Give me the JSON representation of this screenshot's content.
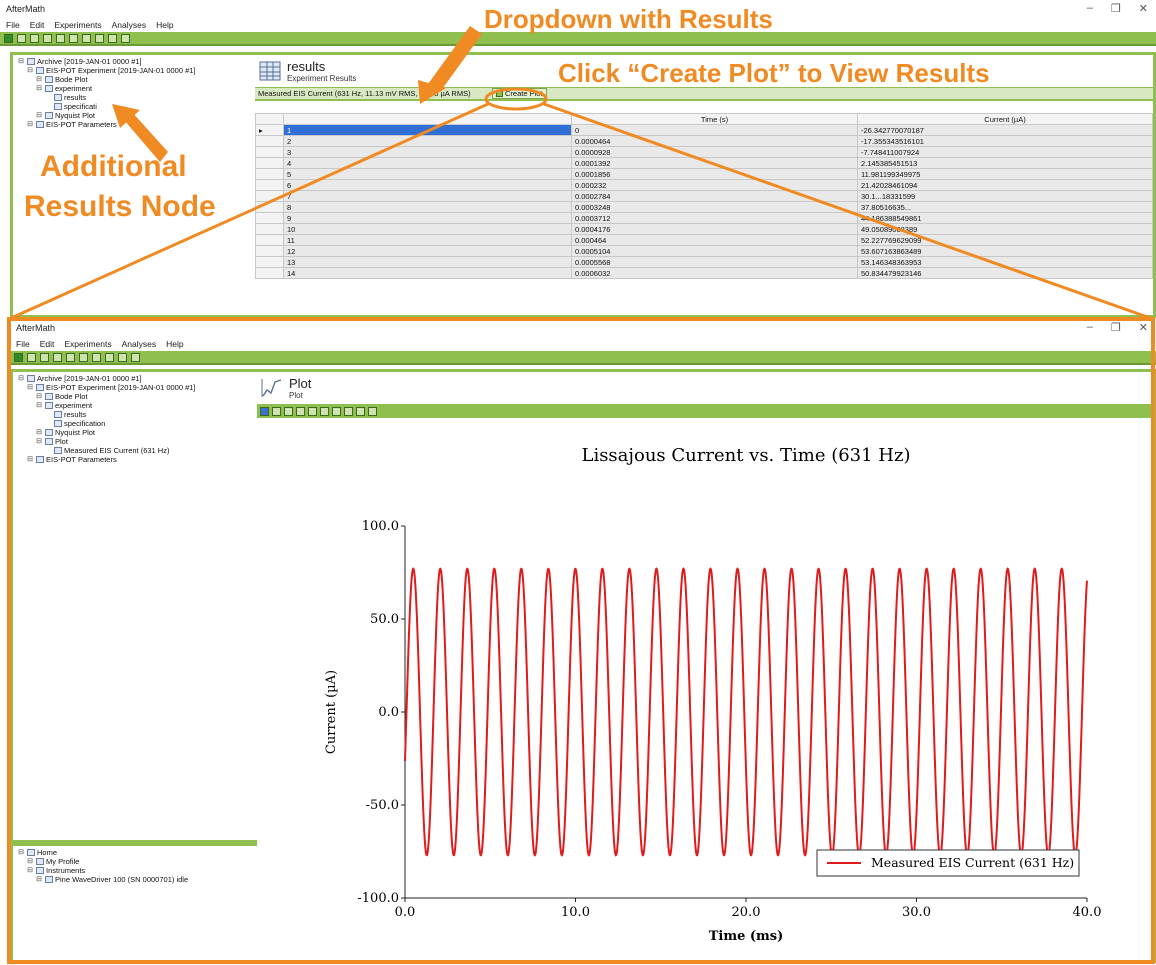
{
  "app": {
    "title": "AfterMath",
    "menu": [
      "File",
      "Edit",
      "Experiments",
      "Analyses",
      "Help"
    ]
  },
  "top": {
    "tree": [
      {
        "label": "Archive [2019-JAN-01 0000 #1]",
        "indent": 0
      },
      {
        "label": "EIS-POT Experiment [2019-JAN-01 0000 #1]",
        "indent": 1
      },
      {
        "label": "Bode Plot",
        "indent": 2
      },
      {
        "label": "experiment",
        "indent": 2
      },
      {
        "label": "results",
        "indent": 3
      },
      {
        "label": "specificati",
        "indent": 3
      },
      {
        "label": "Nyquist Plot",
        "indent": 2
      },
      {
        "label": "EIS-POT Parameters",
        "indent": 1
      }
    ],
    "header_title": "results",
    "header_sub": "Experiment Results",
    "dropdown_value": "Measured EIS Current (631 Hz, 11.13 mV RMS, 54.98 µA RMS)",
    "create_plot": "Create Plot",
    "col_time": "Time (s)",
    "col_current": "Current (µA)",
    "rows": [
      [
        "1",
        "0",
        "-26.342770070187"
      ],
      [
        "2",
        "0.0000464",
        "-17.355343516101"
      ],
      [
        "3",
        "0.0000928",
        "-7.748411007924"
      ],
      [
        "4",
        "0.0001392",
        "2.145385451513"
      ],
      [
        "5",
        "0.0001856",
        "11.981199349975"
      ],
      [
        "6",
        "0.000232",
        "21.42028461094"
      ],
      [
        "7",
        "0.0002784",
        "30.1...18331599"
      ],
      [
        "8",
        "0.0003248",
        "37.80516635..."
      ],
      [
        "9",
        "0.0003712",
        "44.186388549861"
      ],
      [
        "10",
        "0.0004176",
        "49.05089008389"
      ],
      [
        "11",
        "0.000464",
        "52.227769629099"
      ],
      [
        "12",
        "0.0005104",
        "53.607163863489"
      ],
      [
        "13",
        "0.0005568",
        "53.146348363953"
      ],
      [
        "14",
        "0.0006032",
        "50.834479923146"
      ]
    ]
  },
  "bottom": {
    "tree": [
      {
        "label": "Archive [2019-JAN-01 0000 #1]",
        "indent": 0
      },
      {
        "label": "EIS-POT Experiment [2019-JAN-01 0000 #1]",
        "indent": 1
      },
      {
        "label": "Bode Plot",
        "indent": 2
      },
      {
        "label": "experiment",
        "indent": 2
      },
      {
        "label": "results",
        "indent": 3
      },
      {
        "label": "specification",
        "indent": 3
      },
      {
        "label": "Nyquist Plot",
        "indent": 2
      },
      {
        "label": "Plot",
        "indent": 2
      },
      {
        "label": "Measured EIS Current (631 Hz)",
        "indent": 3
      },
      {
        "label": "EIS-POT Parameters",
        "indent": 1
      }
    ],
    "home_tree": [
      {
        "label": "Home",
        "indent": 0
      },
      {
        "label": "My Profile",
        "indent": 1
      },
      {
        "label": "Instruments",
        "indent": 1
      },
      {
        "label": "Pine WaveDriver 100 (SN 0000701) idle",
        "indent": 2
      }
    ],
    "header_title": "Plot",
    "header_sub": "Plot"
  },
  "annotations": {
    "dropdown": "Dropdown with Results",
    "create_plot": "Click “Create Plot” to View Results",
    "additional": "Additional",
    "results_node": "Results Node"
  },
  "colors": {
    "accent": "#8fbf4e",
    "annotation": "#f08a23",
    "series": "#e01b1b"
  },
  "chart_data": {
    "type": "line",
    "title": "Lissajous Current vs. Time (631 Hz)",
    "xlabel": "Time (ms)",
    "ylabel": "Current (µA)",
    "xlim": [
      0,
      40
    ],
    "ylim": [
      -100,
      100
    ],
    "xticks": [
      "0.0",
      "10.0",
      "20.0",
      "30.0",
      "40.0"
    ],
    "yticks": [
      "100.0",
      "50.0",
      "0.0",
      "-50.0",
      "-100.0"
    ],
    "legend_position": "bottom-right",
    "series": [
      {
        "name": "Measured EIS Current (631 Hz)",
        "amplitude": 77,
        "frequency_hz": 631,
        "x_start": 0,
        "x_end": 40,
        "y_start": -26.3
      }
    ]
  }
}
